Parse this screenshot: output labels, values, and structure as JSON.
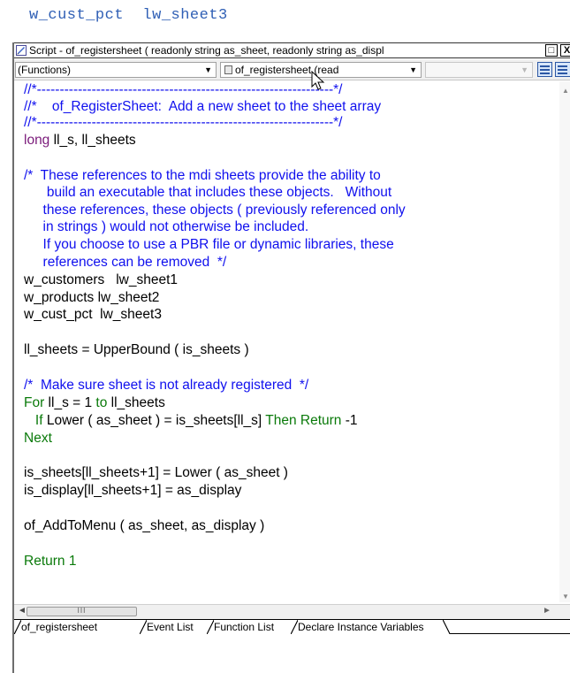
{
  "top_snippet": "w_cust_pct  lw_sheet3",
  "window": {
    "title": "Script - of_registersheet ( readonly string as_sheet, readonly string as_displ",
    "maximize_glyph": "□",
    "close_glyph": "X"
  },
  "toolbar": {
    "functions_dropdown": "(Functions)",
    "object_dropdown": "of_registersheet (read",
    "third_dropdown": "",
    "arrow": "▼"
  },
  "code": [
    {
      "text": "//*-----------------------------------------------------------------*/",
      "kind": "comment"
    },
    {
      "text": "//*    of_RegisterSheet:  Add a new sheet to the sheet array",
      "kind": "comment"
    },
    {
      "text": "//*-----------------------------------------------------------------*/",
      "kind": "comment"
    },
    {
      "text": "long ll_s, ll_sheets",
      "kind": "decl"
    },
    {
      "text": "",
      "kind": "plain"
    },
    {
      "text": "/*  These references to the mdi sheets provide the ability to",
      "kind": "comment"
    },
    {
      "text": "      build an executable that includes these objects.   Without",
      "kind": "comment"
    },
    {
      "text": "     these references, these objects ( previously referenced only",
      "kind": "comment"
    },
    {
      "text": "     in strings ) would not otherwise be included.",
      "kind": "comment"
    },
    {
      "text": "     If you choose to use a PBR file or dynamic libraries, these",
      "kind": "comment"
    },
    {
      "text": "     references can be removed  */",
      "kind": "comment"
    },
    {
      "text": "w_customers   lw_sheet1",
      "kind": "plain"
    },
    {
      "text": "w_products lw_sheet2",
      "kind": "plain"
    },
    {
      "text": "w_cust_pct  lw_sheet3",
      "kind": "plain"
    },
    {
      "text": "",
      "kind": "plain"
    },
    {
      "text": "ll_sheets = UpperBound ( is_sheets )",
      "kind": "plain"
    },
    {
      "text": "",
      "kind": "plain"
    },
    {
      "text": "/*  Make sure sheet is not already registered  */",
      "kind": "comment"
    },
    {
      "text": "For ll_s = 1 to ll_sheets",
      "kind": "for"
    },
    {
      "text": "   If Lower ( as_sheet ) = is_sheets[ll_s] Then Return -1",
      "kind": "if"
    },
    {
      "text": "Next",
      "kind": "keyword"
    },
    {
      "text": "",
      "kind": "plain"
    },
    {
      "text": "is_sheets[ll_sheets+1] = Lower ( as_sheet )",
      "kind": "plain"
    },
    {
      "text": "is_display[ll_sheets+1] = as_display",
      "kind": "plain"
    },
    {
      "text": "",
      "kind": "plain"
    },
    {
      "text": "of_AddToMenu ( as_sheet, as_display )",
      "kind": "plain"
    },
    {
      "text": "",
      "kind": "plain"
    },
    {
      "text": "Return 1",
      "kind": "keyword"
    }
  ],
  "hscroll": {
    "thumb_grip": "III",
    "left_arrow": "◄",
    "right_arrow": "►"
  },
  "vscroll": {
    "up_arrow": "▲",
    "down_arrow": "▼"
  },
  "tabs": [
    "of_registersheet",
    "Event List",
    "Function List",
    "Declare Instance Variables"
  ],
  "colors": {
    "comment": "#1010ee",
    "keyword": "#0a7a0a",
    "type": "#7a1a7a",
    "snippet": "#2f5fb5"
  }
}
